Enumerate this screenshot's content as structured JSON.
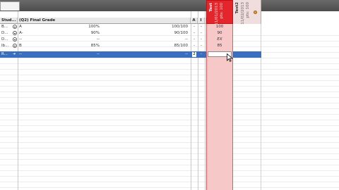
{
  "header": {
    "left_tab": "Student",
    "columns": {
      "student": "Stud...",
      "final_grade": "(Q2) Final Grade",
      "a": "A",
      "i": "I"
    }
  },
  "grade_columns": [
    {
      "title": "Test",
      "date": "11/01/2013",
      "pts": "pts: 100"
    },
    {
      "title": "Test2",
      "date": "11/02/2013",
      "pts": "pts: 100"
    }
  ],
  "rows": [
    {
      "student": "B...",
      "letter": "A",
      "percent": "100%",
      "points": "100/100",
      "a": "-",
      "i": "-",
      "test": "100"
    },
    {
      "student": "D...",
      "letter": "A-",
      "percent": "90%",
      "points": "90/100",
      "a": "-",
      "i": "-",
      "test": "90"
    },
    {
      "student": "D...",
      "letter": "--",
      "percent": "--",
      "points": "--",
      "a": "-",
      "i": "-",
      "test": "EX"
    },
    {
      "student": "Ib...",
      "letter": "B",
      "percent": "85%",
      "points": "85/100",
      "a": "-",
      "i": "-",
      "test": "85"
    },
    {
      "student": "R...",
      "letter": "--",
      "percent": "--",
      "points": "--",
      "a": "2",
      "i": "-",
      "test": ""
    }
  ],
  "colors": {
    "selected": "#3a6fbf",
    "test_column": "#f7c8c8",
    "test_header": "#e4262c"
  }
}
